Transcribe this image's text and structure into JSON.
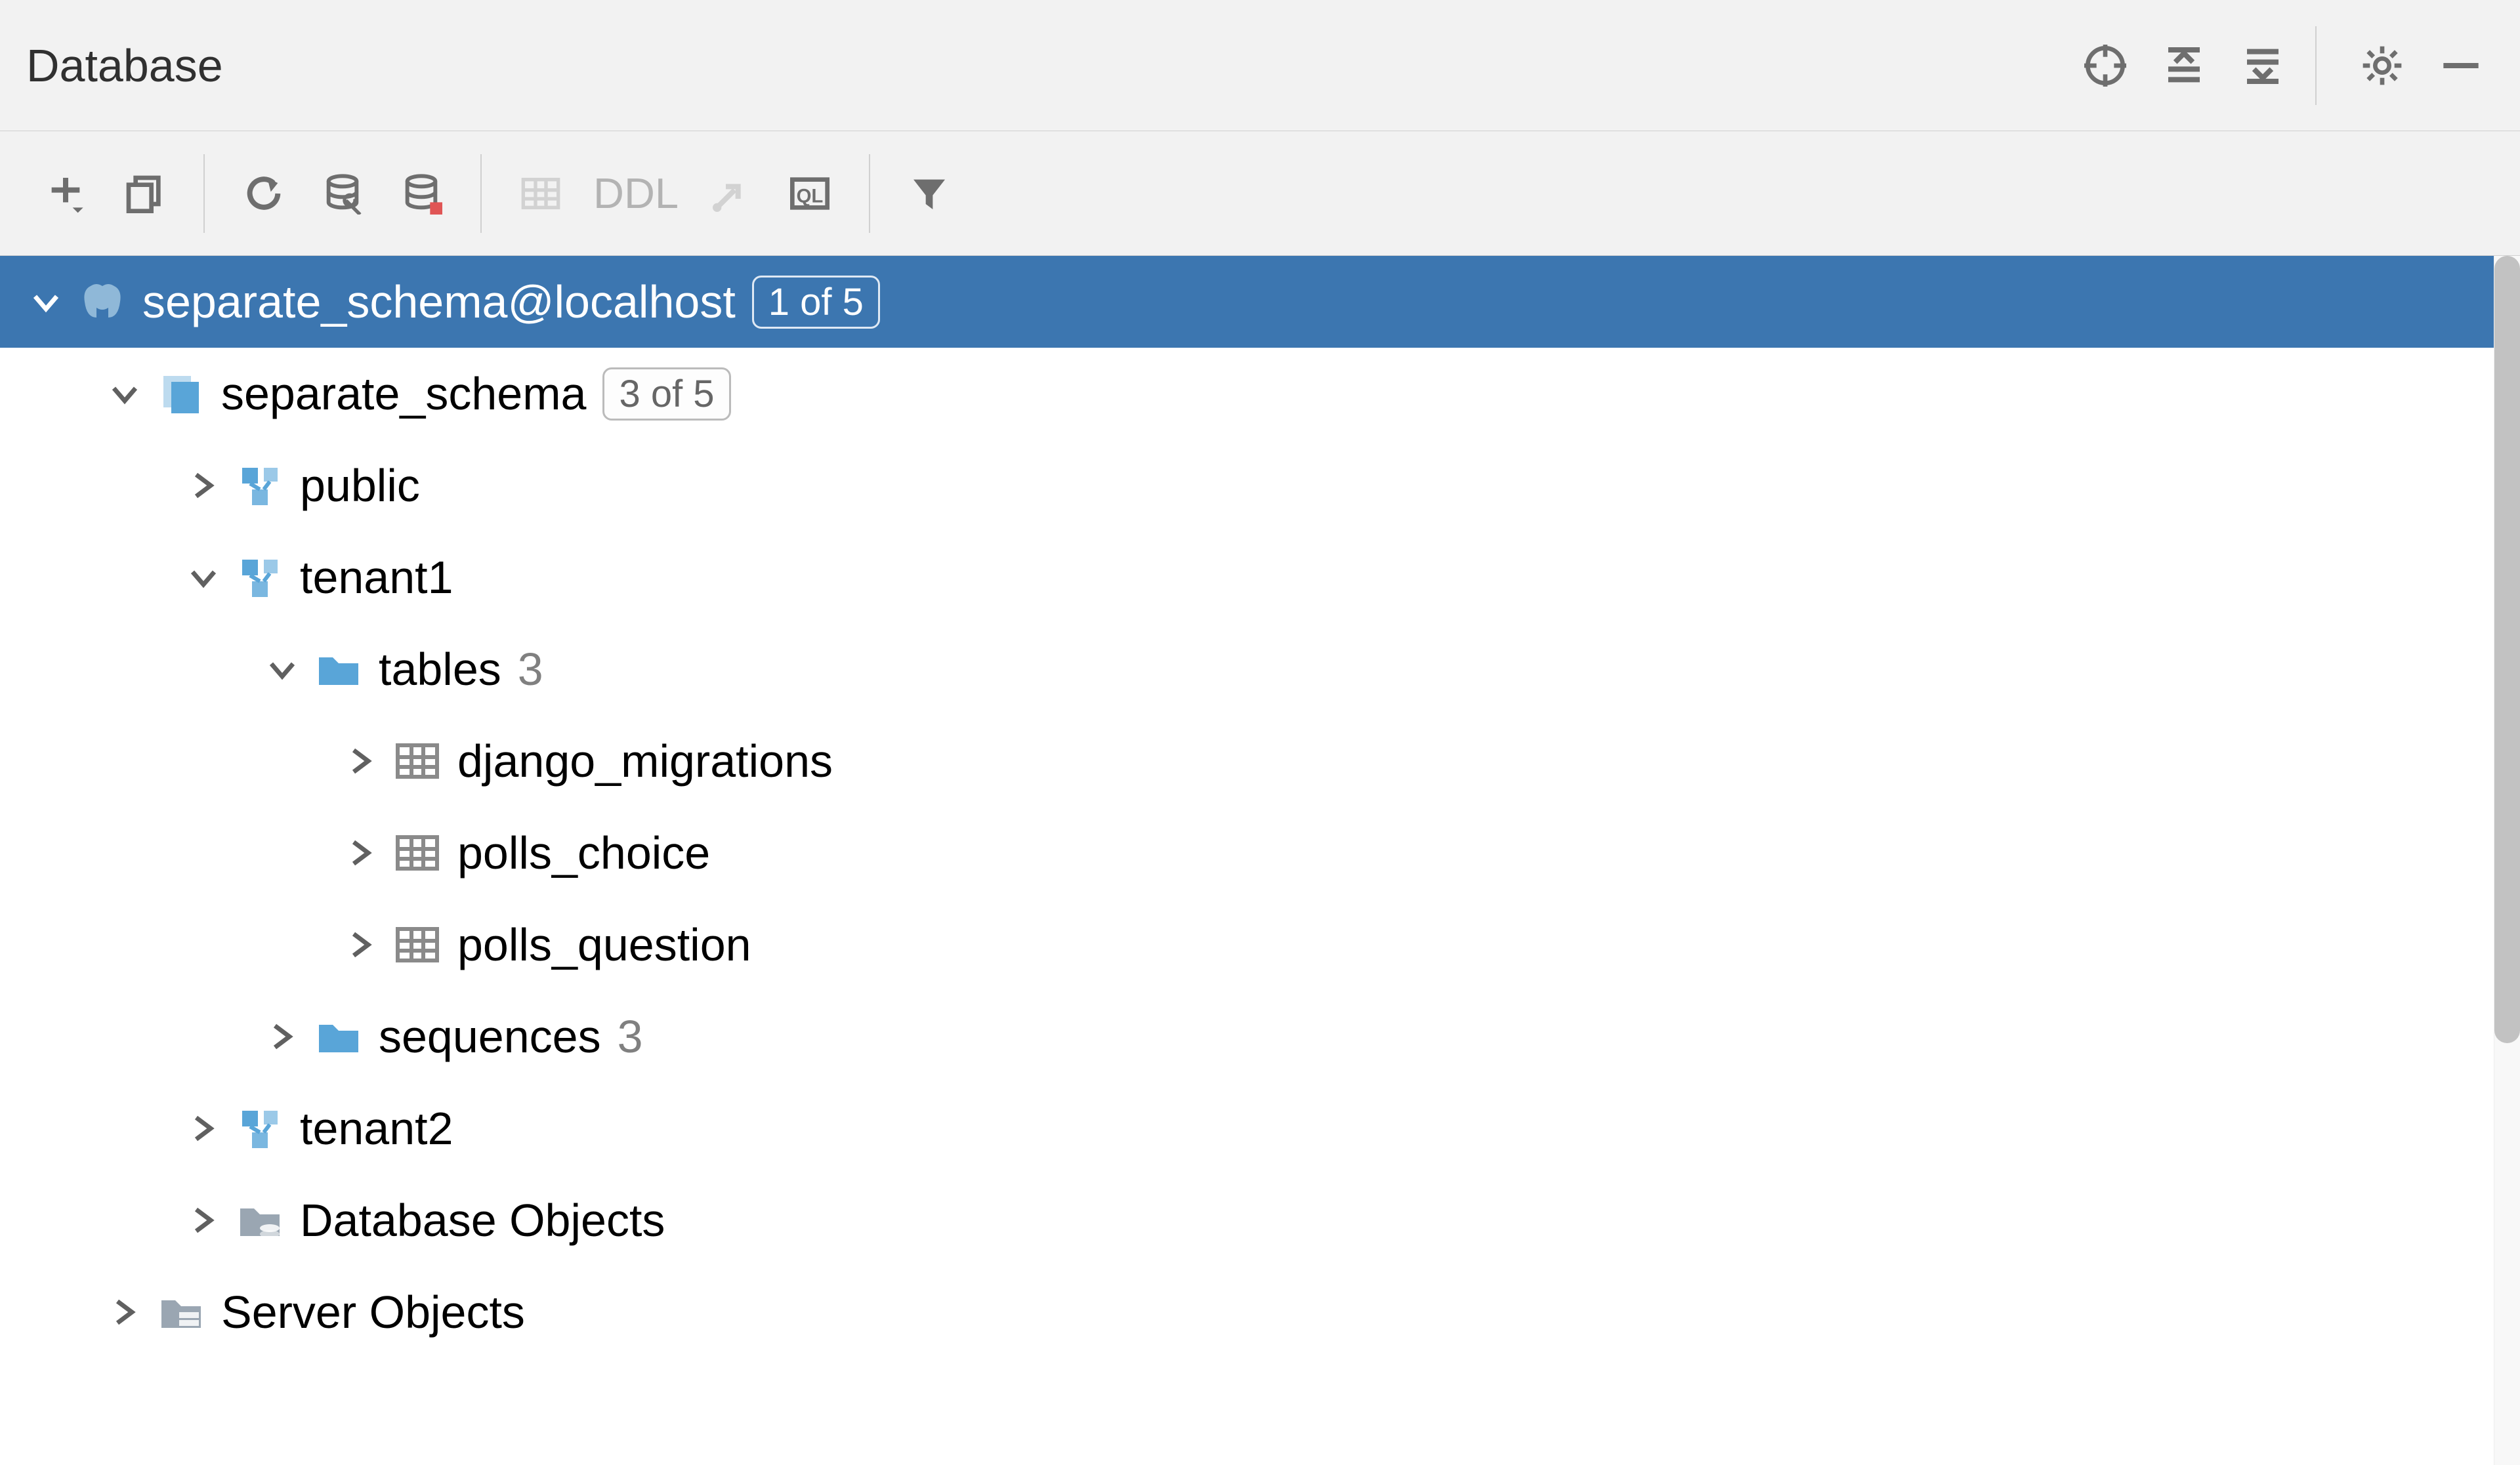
{
  "panel": {
    "title": "Database"
  },
  "toolbar": {
    "ddl_label": "DDL"
  },
  "tree": {
    "root": {
      "label": "separate_schema@localhost",
      "badge": "1 of 5",
      "expanded": true
    },
    "database": {
      "label": "separate_schema",
      "badge": "3 of 5",
      "expanded": true
    },
    "schema_public": {
      "label": "public",
      "expanded": false
    },
    "schema_tenant1": {
      "label": "tenant1",
      "expanded": true
    },
    "tables": {
      "label": "tables",
      "count": "3",
      "expanded": true,
      "items": [
        {
          "label": "django_migrations"
        },
        {
          "label": "polls_choice"
        },
        {
          "label": "polls_question"
        }
      ]
    },
    "sequences": {
      "label": "sequences",
      "count": "3",
      "expanded": false
    },
    "schema_tenant2": {
      "label": "tenant2",
      "expanded": false
    },
    "db_objects": {
      "label": "Database Objects",
      "expanded": false
    },
    "server_objects": {
      "label": "Server Objects",
      "expanded": false
    }
  }
}
